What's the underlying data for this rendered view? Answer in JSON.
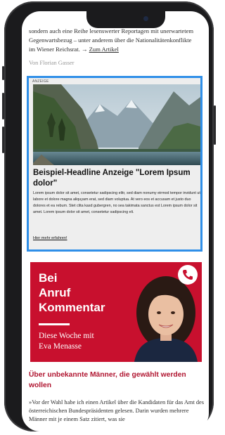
{
  "article": {
    "text_line_1": "sondern auch eine Reihe lesenswerter Reportagen mit unerwartetem",
    "text_line_2": "Gegenwartsbezug – unter anderem über die Nationalitätenkonflikte",
    "text_line_3": "im Wiener Reichsrat. →",
    "link_label": "Zum Artikel",
    "author": "Von Florian Gasser"
  },
  "ad": {
    "label": "ANZEIGE",
    "headline": "Beispiel-Headline Anzeige \"Lorem Ipsum dolor\"",
    "body": "Lorem ipsum dolor sit amet, consetetur sadipscing elitr, sed diam nonumy eirmod tempor invidunt ut labore et dolore magna aliquyam erat, sed diam voluptua. At vero eos et accusam et justo duo dolores et ea rebum. Stet clita kasd gubergren, no sea takimata sanctus est Lorem ipsum dolor sit amet. Lorem ipsum dolor sit amet, consetetur sadipscing eli.",
    "link": "Hier mehr erfahren!"
  },
  "podcast": {
    "title_line_1": "Bei",
    "title_line_2": "Anruf",
    "title_line_3": "Kommentar",
    "subtitle_line_1": "Diese Woche mit",
    "subtitle_line_2": "Eva Menasse",
    "icon": "phone-icon"
  },
  "teaser": {
    "headline": "Über unbekannte Männer, die gewählt werden wollen",
    "text": "»Vor der Wahl habe ich einen Artikel über die Kandidaten für das Amt des österreichischen Bundespräsidenten gelesen. Darin wurden mehrere Männer mit je einem Satz zitiert, was sie"
  },
  "colors": {
    "accent_red": "#c8102e",
    "highlight_blue": "#2f8fe8"
  }
}
